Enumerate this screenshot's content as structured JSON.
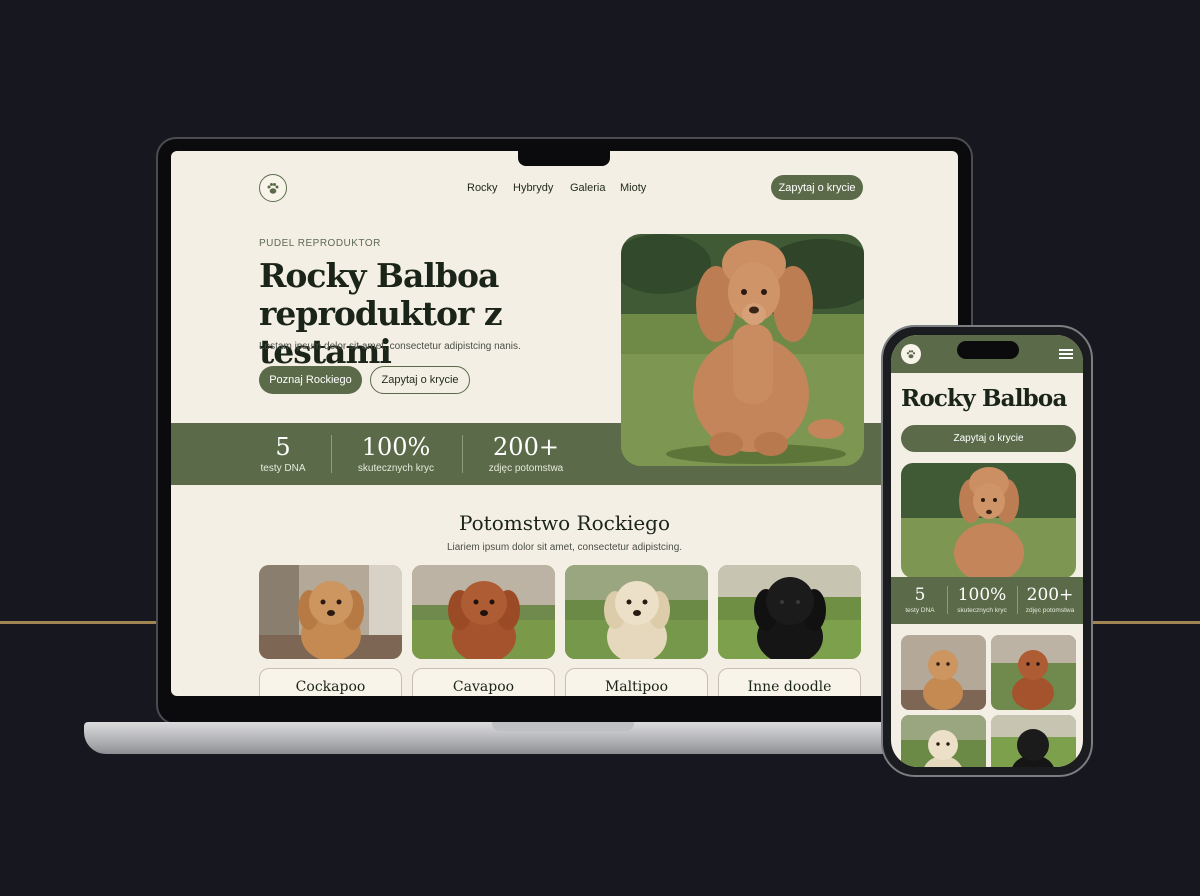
{
  "site": {
    "nav": [
      "Rocky",
      "Hybrydy",
      "Galeria",
      "Mioty"
    ],
    "cta_inquiry": "Zapytaj o krycie",
    "cta_meet": "Poznaj Rockiego"
  },
  "hero": {
    "eyebrow": "PUDEL REPRODUKTOR",
    "title_line1": "Rocky Balboa",
    "title_line2": "reproduktor z testami",
    "subtitle": "Lostam ipsum dolor sit amet, consectetur adipistcing nanis."
  },
  "stats": [
    {
      "value": "5",
      "label": "testy DNA"
    },
    {
      "value": "100%",
      "label": "skutecznych kryc"
    },
    {
      "value": "200+",
      "label": "zdjęc potomstwa"
    }
  ],
  "offspring": {
    "title": "Potomstwo Rockiego",
    "subtitle": "Liariem ipsum dolor sit amet, consectetur adipistcing.",
    "breeds": [
      "Cockapoo",
      "Cavapoo",
      "Maltipoo",
      "Inne doodle"
    ]
  },
  "mobile": {
    "title": "Rocky Balboa",
    "cta": "Zapytaj o krycie",
    "stats": [
      {
        "value": "5",
        "label": "testy DNA"
      },
      {
        "value": "100%",
        "label": "skutecznych kryc"
      },
      {
        "value": "200+",
        "label": "zdjęc potomstwa"
      }
    ]
  },
  "colors": {
    "brand_green": "#5b6b4a",
    "cream": "#f4efe4",
    "backdrop": "#17181f",
    "accent_gold": "#a08452"
  },
  "icons": [
    "paw-icon",
    "hamburger-menu-icon"
  ]
}
